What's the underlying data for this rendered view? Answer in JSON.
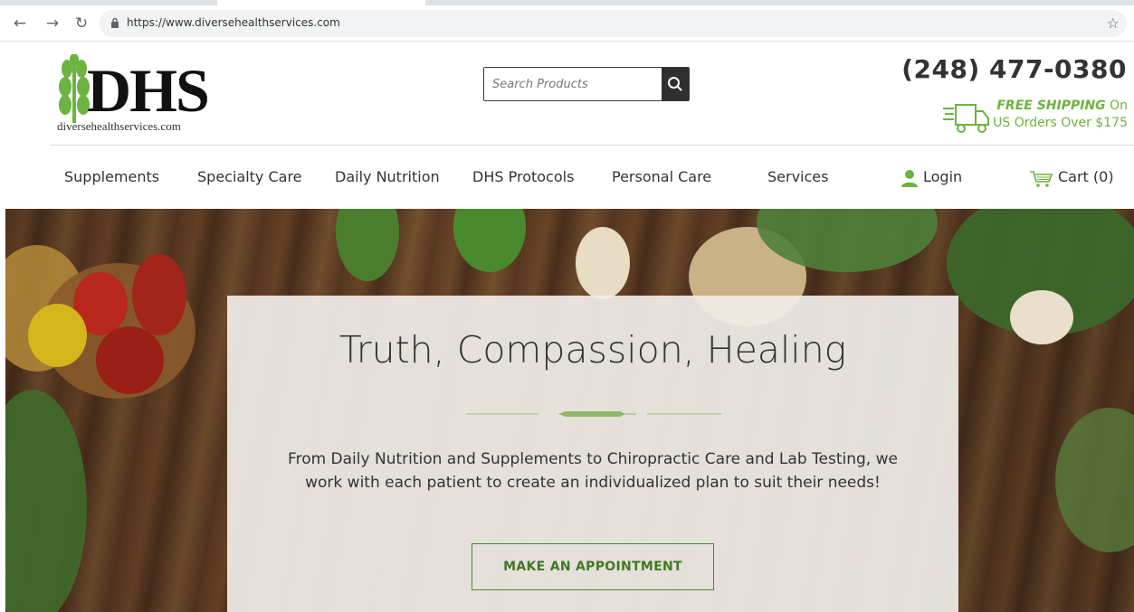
{
  "browser": {
    "url": "https://www.diversehealthservices.com",
    "back_icon": "arrow-left-icon",
    "forward_icon": "arrow-right-icon",
    "reload_icon": "reload-icon",
    "bookmark_icon": "star-icon"
  },
  "header": {
    "logo_text": "DHS",
    "logo_sub": "diversehealthservices.com",
    "search_placeholder": "Search Products",
    "phone": "(248) 477-0380",
    "shipping_bold": "FREE SHIPPING",
    "shipping_on": " On",
    "shipping_line2": "US Orders Over $175"
  },
  "menu": {
    "items": [
      {
        "label": "Supplements"
      },
      {
        "label": "Specialty Care"
      },
      {
        "label": "Daily Nutrition"
      },
      {
        "label": "DHS Protocols"
      },
      {
        "label": "Personal Care"
      },
      {
        "label": "Services"
      }
    ],
    "login": "Login",
    "cart": "Cart (0)"
  },
  "hero": {
    "headline": "Truth, Compassion, Healing",
    "body": "From Daily Nutrition and Supplements to Chiropractic Care and Lab Testing, we work with each patient to create an individualized plan to suit their needs!",
    "cta": "MAKE AN APPOINTMENT"
  },
  "colors": {
    "accent_green": "#6cb33f",
    "cta_green": "#3f7a22",
    "dark": "#333333"
  }
}
